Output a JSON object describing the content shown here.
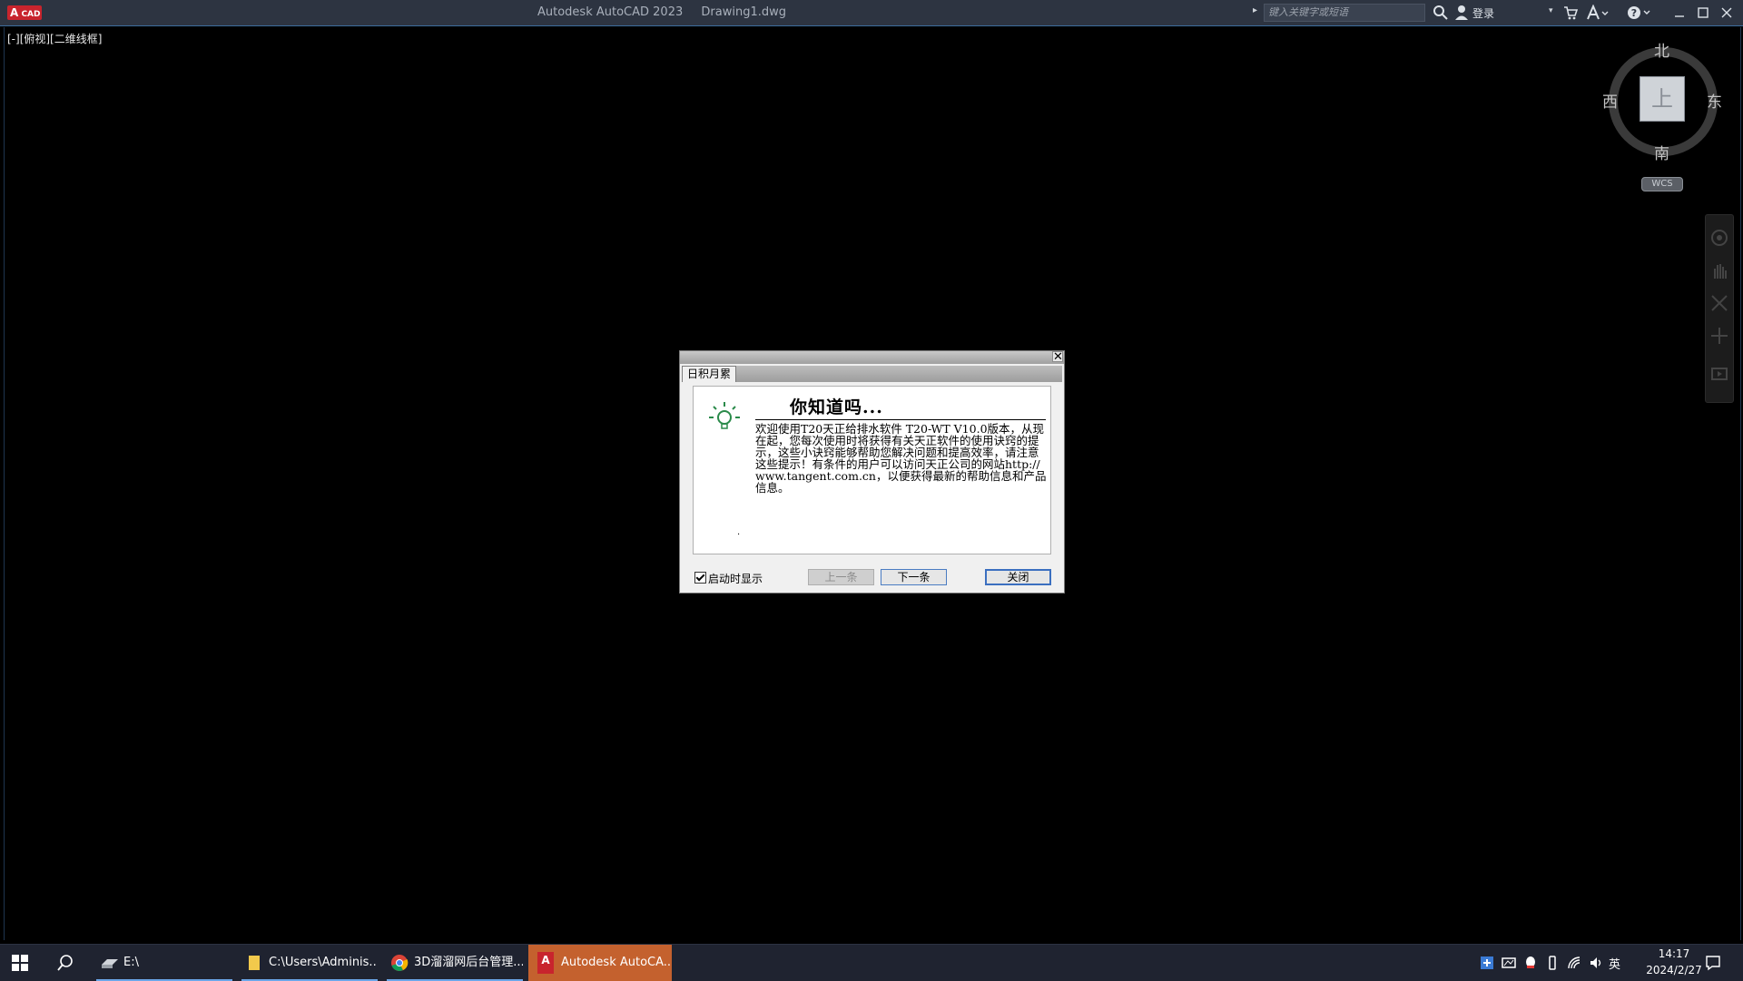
{
  "window": {
    "logo_text": "A",
    "logo_subtext": "CAD",
    "app_name": "Autodesk AutoCAD 2023",
    "document": "Drawing1.dwg",
    "search_placeholder": "键入关键字或短语",
    "login_label": "登录"
  },
  "viewport": {
    "label": "[-][俯视][二维线框]"
  },
  "viewcube": {
    "north": "北",
    "south": "南",
    "west": "西",
    "east": "东",
    "top_face": "上",
    "ucs": "WCS"
  },
  "dialog": {
    "tab": "日积月累",
    "heading": "你知道吗...",
    "body": "欢迎使用T20天正给排水软件 T20-WT V10.0版本，从现在起，您每次使用时将获得有关天正软件的使用诀窍的提示，这些小诀窍能够帮助您解决问题和提高效率，请注意这些提示！有条件的用户可以访问天正公司的网站http://www.tangent.com.cn，以便获得最新的帮助信息和产品信息。",
    "show_on_startup": "启动时显示",
    "prev_button": "上一条",
    "next_button": "下一条",
    "close_button": "关闭"
  },
  "taskbar": {
    "items": [
      {
        "label": "E:\\"
      },
      {
        "label": "C:\\Users\\Adminis..."
      },
      {
        "label": "3D溜溜网后台管理..."
      },
      {
        "label": "Autodesk AutoCA..."
      }
    ],
    "ime": "英",
    "time": "14:17",
    "date": "2024/2/27"
  },
  "colors": {
    "titlebar": "#2d3441",
    "active_task": "#c4612e",
    "autocad_red": "#c8242d"
  }
}
